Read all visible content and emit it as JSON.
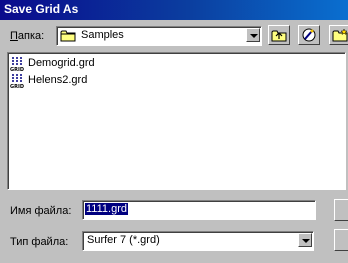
{
  "window": {
    "title": "Save Grid As"
  },
  "folder": {
    "label": "Папка:",
    "current": "Samples"
  },
  "files": [
    {
      "name": "Demogrid.grd",
      "icon": "grid-file-icon"
    },
    {
      "name": "Helens2.grd",
      "icon": "grid-file-icon"
    }
  ],
  "filename": {
    "label": "Имя файла:",
    "value": "1111.grd"
  },
  "filetype": {
    "label": "Тип файла:",
    "value": "Surfer 7 (*.grd)"
  },
  "icons": {
    "up_folder": "up-one-level-icon",
    "new_folder": "create-new-folder-icon",
    "view": "view-menu-icon"
  },
  "colors": {
    "titlebar_start": "#0a0a8c",
    "titlebar_end": "#0a6fd0",
    "selection": "#000080",
    "dialog": "#c0c0c0"
  }
}
